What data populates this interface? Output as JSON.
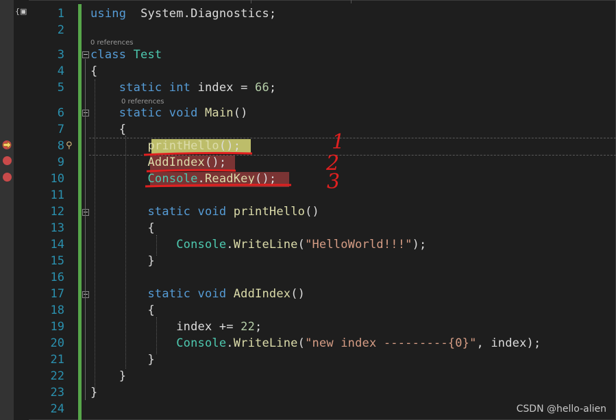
{
  "editor": {
    "codelens_main": "0 references",
    "codelens_class": "0 references",
    "line_numbers": [
      "1",
      "2",
      "3",
      "4",
      "5",
      "6",
      "7",
      "8",
      "9",
      "10",
      "11",
      "12",
      "13",
      "14",
      "15",
      "16",
      "17",
      "18",
      "19",
      "20",
      "21",
      "22",
      "23",
      "24"
    ],
    "lines": [
      {
        "n": "1",
        "tokens": [
          [
            "kw",
            "using"
          ],
          [
            "",
            "  "
          ],
          [
            "",
            "System.Diagnostics;"
          ]
        ]
      },
      {
        "n": "2",
        "tokens": []
      },
      {
        "n": "3",
        "tokens": [
          [
            "kw",
            "class"
          ],
          [
            "",
            " "
          ],
          [
            "ty",
            "Test"
          ]
        ]
      },
      {
        "n": "4",
        "tokens": [
          [
            "",
            "{"
          ]
        ]
      },
      {
        "n": "5",
        "tokens": [
          [
            "",
            "    "
          ],
          [
            "kw",
            "static"
          ],
          [
            "",
            " "
          ],
          [
            "kw",
            "int"
          ],
          [
            "",
            " index = "
          ],
          [
            "num",
            "66"
          ],
          [
            "",
            ";"
          ]
        ]
      },
      {
        "n": "6",
        "tokens": [
          [
            "",
            "    "
          ],
          [
            "kw",
            "static"
          ],
          [
            "",
            " "
          ],
          [
            "kw",
            "void"
          ],
          [
            "",
            " "
          ],
          [
            "fn",
            "Main"
          ],
          [
            "",
            "()"
          ]
        ]
      },
      {
        "n": "7",
        "tokens": [
          [
            "",
            "    {"
          ]
        ]
      },
      {
        "n": "8",
        "tokens": [
          [
            "",
            "        "
          ],
          [
            "fn",
            "printHello"
          ],
          [
            "",
            "();"
          ]
        ]
      },
      {
        "n": "9",
        "tokens": [
          [
            "",
            "        "
          ],
          [
            "fn",
            "AddIndex"
          ],
          [
            "",
            "();"
          ]
        ]
      },
      {
        "n": "10",
        "tokens": [
          [
            "",
            "        "
          ],
          [
            "ty",
            "Console"
          ],
          [
            "",
            "."
          ],
          [
            "fn",
            "ReadKey"
          ],
          [
            "",
            "();"
          ]
        ]
      },
      {
        "n": "11",
        "tokens": []
      },
      {
        "n": "12",
        "tokens": [
          [
            "",
            "        "
          ],
          [
            "kw",
            "static"
          ],
          [
            "",
            " "
          ],
          [
            "kw",
            "void"
          ],
          [
            "",
            " "
          ],
          [
            "fn",
            "printHello"
          ],
          [
            "",
            "()"
          ]
        ]
      },
      {
        "n": "13",
        "tokens": [
          [
            "",
            "        {"
          ]
        ]
      },
      {
        "n": "14",
        "tokens": [
          [
            "",
            "            "
          ],
          [
            "ty",
            "Console"
          ],
          [
            "",
            "."
          ],
          [
            "fn",
            "WriteLine"
          ],
          [
            "",
            "("
          ],
          [
            "st",
            "\"HelloWorld!!!\""
          ],
          [
            "",
            ");"
          ]
        ]
      },
      {
        "n": "15",
        "tokens": [
          [
            "",
            "        }"
          ]
        ]
      },
      {
        "n": "16",
        "tokens": []
      },
      {
        "n": "17",
        "tokens": [
          [
            "",
            "        "
          ],
          [
            "kw",
            "static"
          ],
          [
            "",
            " "
          ],
          [
            "kw",
            "void"
          ],
          [
            "",
            " "
          ],
          [
            "fn",
            "AddIndex"
          ],
          [
            "",
            "()"
          ]
        ]
      },
      {
        "n": "18",
        "tokens": [
          [
            "",
            "        {"
          ]
        ]
      },
      {
        "n": "19",
        "tokens": [
          [
            "",
            "            index += "
          ],
          [
            "num",
            "22"
          ],
          [
            "",
            ";"
          ]
        ]
      },
      {
        "n": "20",
        "tokens": [
          [
            "",
            "            "
          ],
          [
            "ty",
            "Console"
          ],
          [
            "",
            "."
          ],
          [
            "fn",
            "WriteLine"
          ],
          [
            "",
            "("
          ],
          [
            "st",
            "\"new index ---------{0}\""
          ],
          [
            "",
            ", index);"
          ]
        ]
      },
      {
        "n": "21",
        "tokens": [
          [
            "",
            "        }"
          ]
        ]
      },
      {
        "n": "22",
        "tokens": [
          [
            "",
            "    }"
          ]
        ]
      },
      {
        "n": "23",
        "tokens": [
          [
            "",
            "}"
          ]
        ]
      },
      {
        "n": "24",
        "tokens": []
      }
    ]
  },
  "breakpoints": {
    "current_line": "8",
    "lines": [
      "9",
      "10"
    ]
  },
  "annotations": {
    "labels": [
      "1",
      "2",
      "3"
    ],
    "color": "#e02020"
  },
  "colors": {
    "background": "#1e1e1e",
    "line_number": "#2b91af",
    "keyword": "#569cd6",
    "type": "#4ec9b0",
    "method": "#dcdcaa",
    "string": "#d69d85",
    "number": "#b5cea8",
    "breakpoint": "#c94a4a",
    "current_highlight": "#bdbd6a",
    "change_bar": "#57a64a"
  },
  "icons": {
    "scope": "scope-icon",
    "lightbulb": "lightbulb-icon",
    "arrow": "current-statement-arrow-icon"
  },
  "watermark": "CSDN @hello-alien"
}
